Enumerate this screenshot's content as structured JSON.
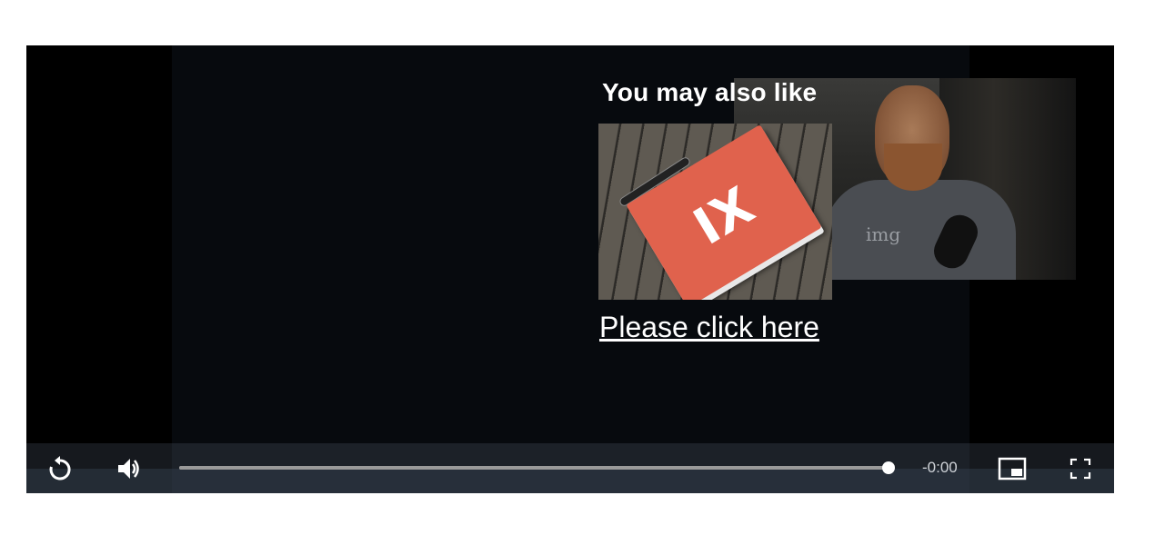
{
  "overlay": {
    "title": "You may also like",
    "link_text": "Please click here",
    "thumbnail_logo": "IX",
    "shirt_text": "img"
  },
  "controls": {
    "replay_icon": "replay-icon",
    "volume_icon": "volume-icon",
    "progress_fraction": 1.0,
    "time_remaining": "-0:00",
    "pip_icon": "picture-in-picture-icon",
    "fullscreen_icon": "fullscreen-icon"
  },
  "colors": {
    "player_bg": "#000000",
    "video_bg": "#070a0e",
    "notebook_accent": "#e0624d",
    "control_text": "#cfd3d8"
  }
}
